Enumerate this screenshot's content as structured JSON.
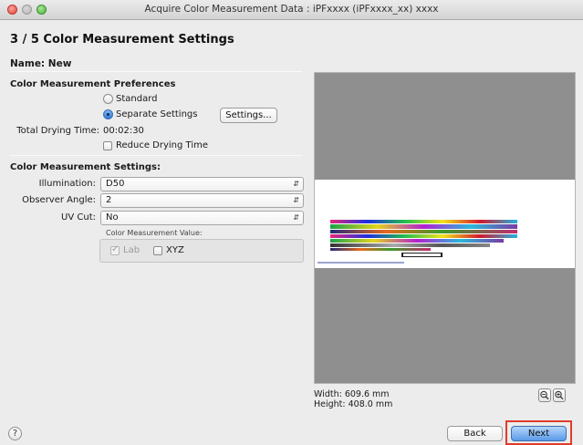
{
  "window": {
    "title": "Acquire Color Measurement Data : iPFxxxx (iPFxxxx_xx) xxxx"
  },
  "page": {
    "step_title": "3 / 5  Color Measurement Settings",
    "name_label": "Name: New"
  },
  "preferences": {
    "heading": "Color Measurement Preferences",
    "standard_label": "Standard",
    "separate_label": "Separate Settings",
    "selected": "Separate Settings",
    "settings_button": "Settings...",
    "drying_label": "Total Drying Time:",
    "drying_value": "00:02:30",
    "reduce_drying_label": "Reduce Drying Time",
    "reduce_drying_checked": false
  },
  "settings": {
    "heading": "Color Measurement Settings:",
    "illumination_label": "Illumination:",
    "illumination_value": "D50",
    "observer_label": "Observer Angle:",
    "observer_value": "2",
    "uvcut_label": "UV Cut:",
    "uvcut_value": "No",
    "value_group_label": "Color Measurement Value:",
    "lab_label": "Lab",
    "lab_checked": true,
    "lab_enabled": false,
    "xyz_label": "XYZ",
    "xyz_checked": false
  },
  "preview": {
    "width_text": "Width: 609.6 mm",
    "height_text": "Height: 408.0 mm"
  },
  "footer": {
    "help_symbol": "?",
    "back_label": "Back",
    "next_label": "Next"
  },
  "icons": {
    "zoom_out": "zoom-out-icon",
    "zoom_in": "zoom-in-icon"
  },
  "colors": {
    "highlight": "#e03c2c",
    "default_button": "#5a9ae8",
    "preview_gray": "#8f8f8f"
  }
}
